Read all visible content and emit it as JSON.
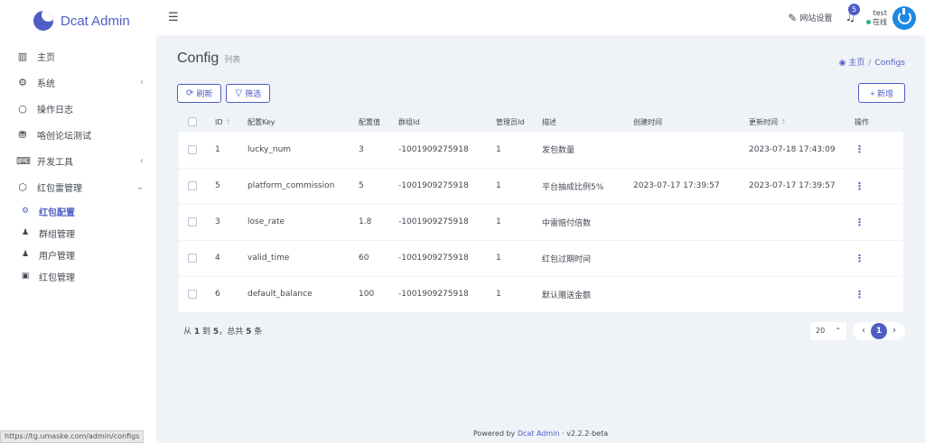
{
  "app": {
    "name": "Dcat Admin"
  },
  "sidebar": {
    "items": [
      {
        "icon": "bar-chart-icon",
        "glyph": "▥",
        "label": "主页",
        "arrow": ""
      },
      {
        "icon": "gear-icon",
        "glyph": "⚙",
        "label": "系统",
        "arrow": "‹"
      },
      {
        "icon": "circle-icon",
        "glyph": "○",
        "label": "操作日志",
        "arrow": ""
      },
      {
        "icon": "coins-icon",
        "glyph": "⛃",
        "label": "咯创论坛测试",
        "arrow": ""
      },
      {
        "icon": "keyboard-icon",
        "glyph": "⌨",
        "label": "开发工具",
        "arrow": "‹"
      },
      {
        "icon": "cube-icon",
        "glyph": "⬡",
        "label": "红包雷管理",
        "arrow": "⌄"
      }
    ],
    "subitems": [
      {
        "icon": "gear-icon",
        "glyph": "⚙",
        "label": "红包配置"
      },
      {
        "icon": "users-icon",
        "glyph": "♟",
        "label": "群组管理"
      },
      {
        "icon": "user-icon",
        "glyph": "♟",
        "label": "用户管理"
      },
      {
        "icon": "briefcase-icon",
        "glyph": "▣",
        "label": "红包管理"
      }
    ]
  },
  "status_url": "https://tg.umaske.com/admin/configs",
  "navbar": {
    "site_setting": "网站设置",
    "notifications": "5",
    "user_name": "test",
    "user_status": "在线"
  },
  "page": {
    "title": "Config",
    "subtitle": "列表",
    "breadcrumb_home": "主页",
    "breadcrumb_sep": "/",
    "breadcrumb_current": "Configs"
  },
  "toolbar": {
    "refresh": "刷新",
    "filter": "筛选",
    "new": "+ 新增"
  },
  "table": {
    "headers": {
      "id": "ID",
      "key": "配置Key",
      "value": "配置值",
      "group": "群组Id",
      "admin": "管理员Id",
      "desc": "描述",
      "created": "创建时间",
      "updated": "更新时间",
      "ops": "操作"
    },
    "rows": [
      {
        "id": "1",
        "key": "lucky_num",
        "value": "3",
        "group": "-1001909275918",
        "admin": "1",
        "desc": "发包数量",
        "created": "",
        "updated": "2023-07-18 17:43:09"
      },
      {
        "id": "5",
        "key": "platform_commission",
        "value": "5",
        "group": "-1001909275918",
        "admin": "1",
        "desc": "平台抽成比例5%",
        "created": "2023-07-17 17:39:57",
        "updated": "2023-07-17 17:39:57"
      },
      {
        "id": "3",
        "key": "lose_rate",
        "value": "1.8",
        "group": "-1001909275918",
        "admin": "1",
        "desc": "中雷赔付倍数",
        "created": "",
        "updated": ""
      },
      {
        "id": "4",
        "key": "valid_time",
        "value": "60",
        "group": "-1001909275918",
        "admin": "1",
        "desc": "红包过期时间",
        "created": "",
        "updated": ""
      },
      {
        "id": "6",
        "key": "default_balance",
        "value": "100",
        "group": "-1001909275918",
        "admin": "1",
        "desc": "默认赠送金额",
        "created": "",
        "updated": ""
      }
    ]
  },
  "pagination": {
    "summary_prefix": "从",
    "from": "1",
    "summary_to": "到",
    "to": "5",
    "summary_total_prefix": "，总共",
    "total": "5",
    "summary_suffix": "条",
    "per_page": "20",
    "current_page": "1"
  },
  "footer": {
    "powered_prefix": "Powered by",
    "powered_link": "Dcat Admin",
    "version": "· v2.2.2-beta"
  }
}
